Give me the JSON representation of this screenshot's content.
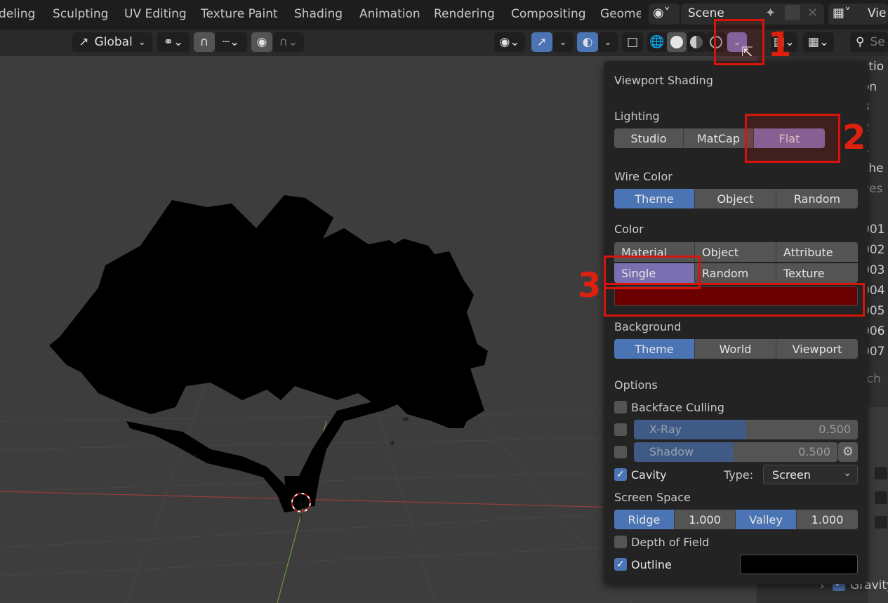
{
  "workspace_tabs": [
    "deling",
    "Sculpting",
    "UV Editing",
    "Texture Paint",
    "Shading",
    "Animation",
    "Rendering",
    "Compositing",
    "Geomet"
  ],
  "scene_name": "Scene",
  "view_layer_label": "Vie",
  "header": {
    "orientation": "Global",
    "search_placeholder": "Se"
  },
  "side_panel": {
    "title": "ctio",
    "rows": [
      "on",
      "3",
      "2",
      "1",
      "che",
      "ves",
      "001",
      "002",
      "003",
      "004",
      "005",
      "006",
      "007",
      "rch"
    ],
    "gravity_label": "Gravity"
  },
  "popover": {
    "title": "Viewport Shading",
    "lighting": {
      "label": "Lighting",
      "options": [
        "Studio",
        "MatCap",
        "Flat"
      ],
      "selected": "Flat"
    },
    "wire_color": {
      "label": "Wire Color",
      "options": [
        "Theme",
        "Object",
        "Random"
      ],
      "selected": "Theme"
    },
    "color": {
      "label": "Color",
      "row1": [
        "Material",
        "Object",
        "Attribute"
      ],
      "row2": [
        "Single",
        "Random",
        "Texture"
      ],
      "selected": "Single",
      "single_color": "#6a0000"
    },
    "background": {
      "label": "Background",
      "options": [
        "Theme",
        "World",
        "Viewport"
      ],
      "selected": "Theme"
    },
    "options": {
      "label": "Options",
      "backface_culling": {
        "label": "Backface Culling",
        "checked": false
      },
      "xray": {
        "label": "X-Ray",
        "value": "0.500",
        "checked": false,
        "fraction": 0.5
      },
      "shadow": {
        "label": "Shadow",
        "value": "0.500",
        "checked": false,
        "fraction": 0.5
      },
      "cavity": {
        "label": "Cavity",
        "checked": true,
        "type_label": "Type:",
        "type_value": "Screen"
      },
      "screen_space": {
        "label": "Screen Space",
        "ridge_label": "Ridge",
        "ridge_value": "1.000",
        "valley_label": "Valley",
        "valley_value": "1.000"
      },
      "depth_of_field": {
        "label": "Depth of Field",
        "checked": false
      },
      "outline": {
        "label": "Outline",
        "checked": true,
        "color": "#000000"
      }
    }
  },
  "annotations": [
    "1",
    "2",
    "3"
  ],
  "colors": {
    "accent_blue": "#4a74b3",
    "accent_purple": "#7a6fb0",
    "annotation_red": "#d8140a"
  }
}
